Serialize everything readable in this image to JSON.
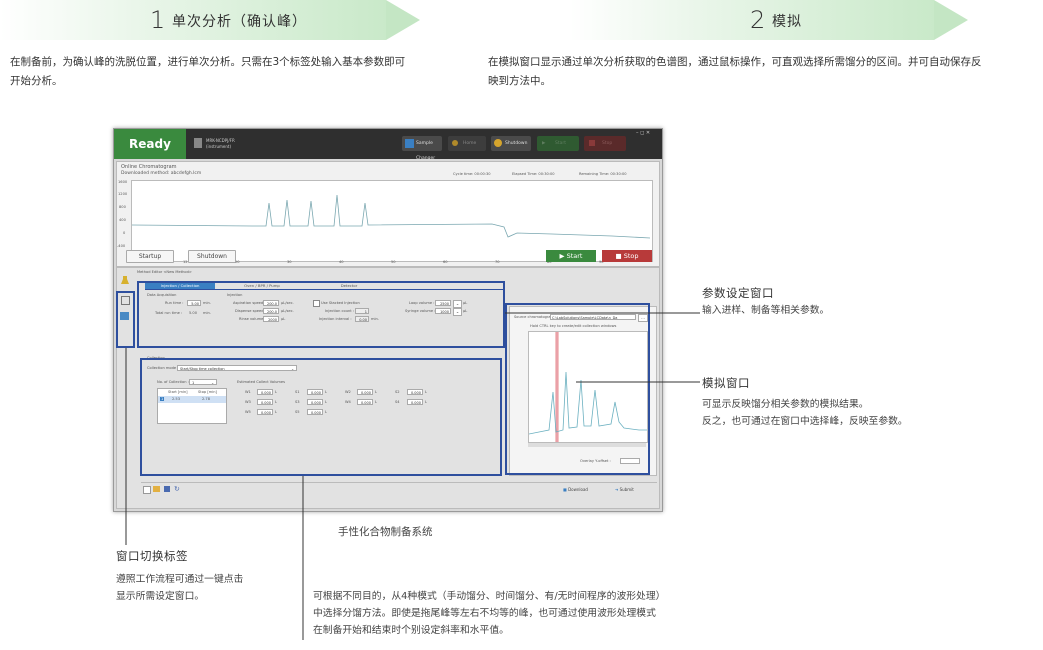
{
  "steps": [
    {
      "number": "1",
      "title": "单次分析（确认峰）",
      "description_lines": [
        "在制备前，为确认峰的洗脱位置，进行单次分析。只需在3个标签处输入基本参数即可",
        "开始分析。"
      ]
    },
    {
      "number": "2",
      "title": "模拟",
      "description_lines": [
        "在模拟窗口显示通过单次分析获取的色谱图，通过鼠标操作，可直观选择所需馏分的区间。并可自动保存反",
        "映到方法中。"
      ]
    }
  ],
  "app": {
    "status": "Ready",
    "instrument_line1": "MRK-NCDPJ/FR",
    "instrument_line2": "(instrument)",
    "buttons": {
      "sample_changer": "Sample Changer",
      "home": "Home",
      "shutdown_top": "Shutdown",
      "start_top": "Start",
      "stop_top": "Stop"
    },
    "chromatogram": {
      "title": "Online Chromatogram",
      "method": "Downloaded method: abcdefgh.lcm",
      "cycle_time": "Cycle time: 00:00:30",
      "elapsed_time": "Elapsed Time: 00:30:00",
      "remaining_time": "Remaining Time: 00:30:00",
      "y_ticks": [
        "1600",
        "1200",
        "800",
        "400",
        "0",
        "-400"
      ],
      "x_ticks": [
        "10",
        "12",
        "20",
        "30",
        "40",
        "50",
        "60",
        "70",
        "80",
        "90"
      ]
    },
    "startup": "Startup",
    "shutdown": "Shutdown",
    "start": "Start",
    "stop": "Stop",
    "method_editor": "Method Editor  <New Method>",
    "tabs": [
      "Injection / Collection",
      "Oven / BPR / Pump",
      "Detector"
    ],
    "data_acquisition": "Data Acquisition",
    "run_time_label": "Run time :",
    "run_time": "5.00",
    "min": "min.",
    "total_run_label": "Total run time :",
    "total_run": "5.00",
    "injection": "Injection",
    "aspiration_label": "Aspiration speed :",
    "aspiration": "200.0",
    "ul_sec": "µL/sec.",
    "dispense_label": "Dispense speed :",
    "dispense": "200.0",
    "rinse_label": "Rinse volume :",
    "rinse": "2000",
    "ul": "µL",
    "stacked_label": "Use Stacked Injection",
    "inj_count_label": "Injection count :",
    "inj_count": "1",
    "inj_interval_label": "Injection interval :",
    "inj_interval": "0.00",
    "loop_label": "Loop volume :",
    "loop": "2500",
    "syringe_label": "Syringe volume :",
    "syringe": "1000",
    "collection": "Collection",
    "collection_mode_label": "Collection mode :",
    "collection_mode": "Start/Stop time collection",
    "num_collection_label": "No. of Collection :",
    "num_collection": "1",
    "est_volume_label": "Estimated Collect Volumes",
    "table_headers": [
      "Start [min]",
      "Stop [min]"
    ],
    "table_row": [
      "1",
      "2.53",
      "2.78"
    ],
    "volumes": [
      [
        "W1",
        "0.000",
        "S1",
        "0.000",
        "W2",
        "0.000",
        "S2",
        "0.000"
      ],
      [
        "W3",
        "0.000",
        "S3",
        "0.000",
        "W4",
        "0.000",
        "S4",
        "0.000"
      ],
      [
        "W5",
        "0.000",
        "S5",
        "0.000"
      ]
    ],
    "source_label": "Source chromatogram :",
    "source_path": "C:\\LabSolutions\\Sample\\LCData\\n_Da",
    "hold_ctrl": "Hold CTRL key to create/edit collection windows",
    "overlay": "Overlay Y-offset :",
    "download": "Download",
    "submit": "Submit"
  },
  "callouts": {
    "param_title": "参数设定窗口",
    "param_text": "输入进样、制备等相关参数。",
    "sim_title": "模拟窗口",
    "sim_text": [
      "可显示反映馏分相关参数的模拟结果。",
      "反之，也可通过在窗口中选择峰，反映至参数。"
    ],
    "custom_system": "手性化合物制备系统",
    "tab_title": "窗口切换标签",
    "tab_text": [
      "遵照工作流程可通过一键点击",
      "显示所需设定窗口。"
    ],
    "mode_text": [
      "可根据不同目的，从4种模式（手动馏分、时间馏分、有/无时间程序的波形处理）",
      "中选择分馏方法。即使是拖尾峰等左右不均等的峰，也可通过使用波形处理模式",
      "在制备开始和结束时个别设定斜率和水平值。"
    ]
  }
}
